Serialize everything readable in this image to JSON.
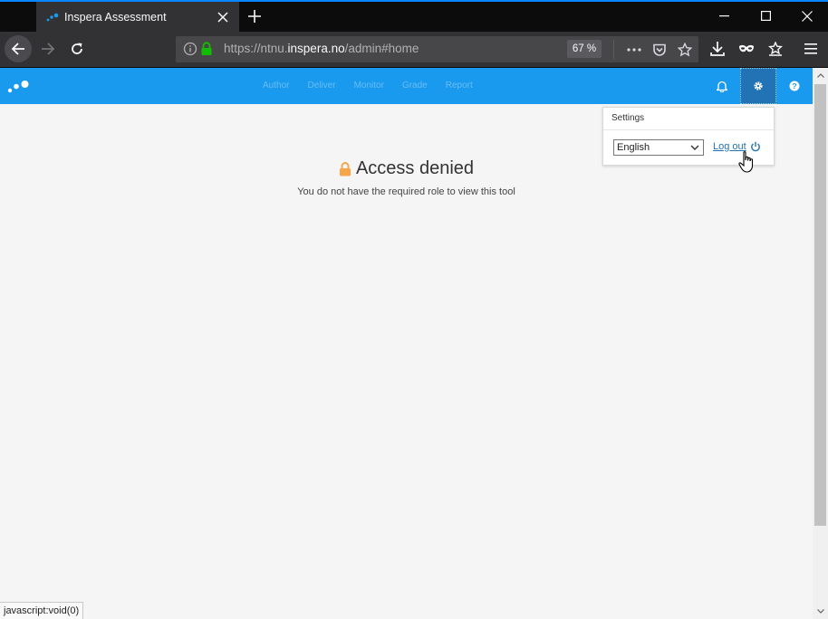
{
  "browser": {
    "tab_title": "Inspera Assessment",
    "url_prefix": "https://ntnu.",
    "url_domain": "inspera.no",
    "url_path": "/admin#home",
    "zoom": "67 %"
  },
  "app": {
    "nav": [
      "Author",
      "Deliver",
      "Monitor",
      "Grade",
      "Report"
    ],
    "accent_color": "#1a9aef"
  },
  "settings": {
    "header": "Settings",
    "language": "English",
    "logout_label": "Log out"
  },
  "content": {
    "heading": "Access denied",
    "message": "You do not have the required role to view this tool"
  },
  "status_text": "javascript:void(0)"
}
